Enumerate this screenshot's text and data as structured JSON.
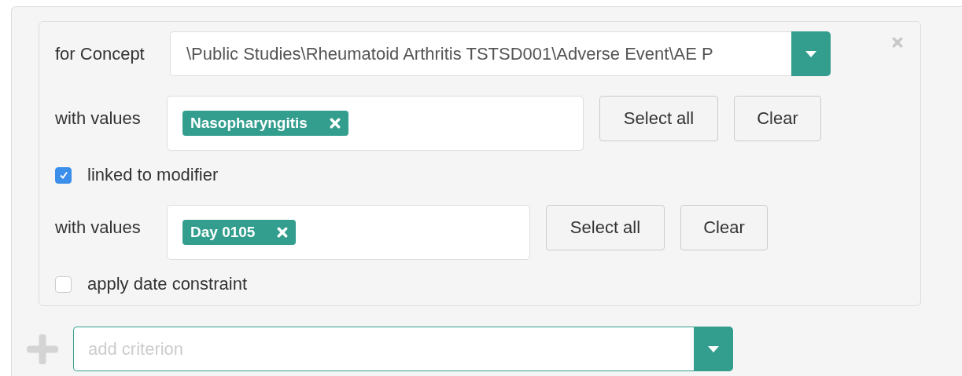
{
  "concept": {
    "label": "for Concept",
    "value": "\\Public Studies\\Rheumatoid Arthritis TSTSD001\\Adverse Event\\AE P"
  },
  "rows": [
    {
      "kind": "values",
      "label": "with values",
      "tags": [
        "Nasopharyngitis"
      ],
      "buttons": [
        "Select all",
        "Clear"
      ]
    },
    {
      "kind": "checkbox",
      "label": "linked to modifier",
      "checked": true
    },
    {
      "kind": "values",
      "label": "with values",
      "tags": [
        "Day 0105"
      ],
      "buttons": [
        "Select all",
        "Clear"
      ]
    },
    {
      "kind": "checkbox",
      "label": "apply date constraint",
      "checked": false
    }
  ],
  "add": {
    "placeholder": "add criterion"
  }
}
